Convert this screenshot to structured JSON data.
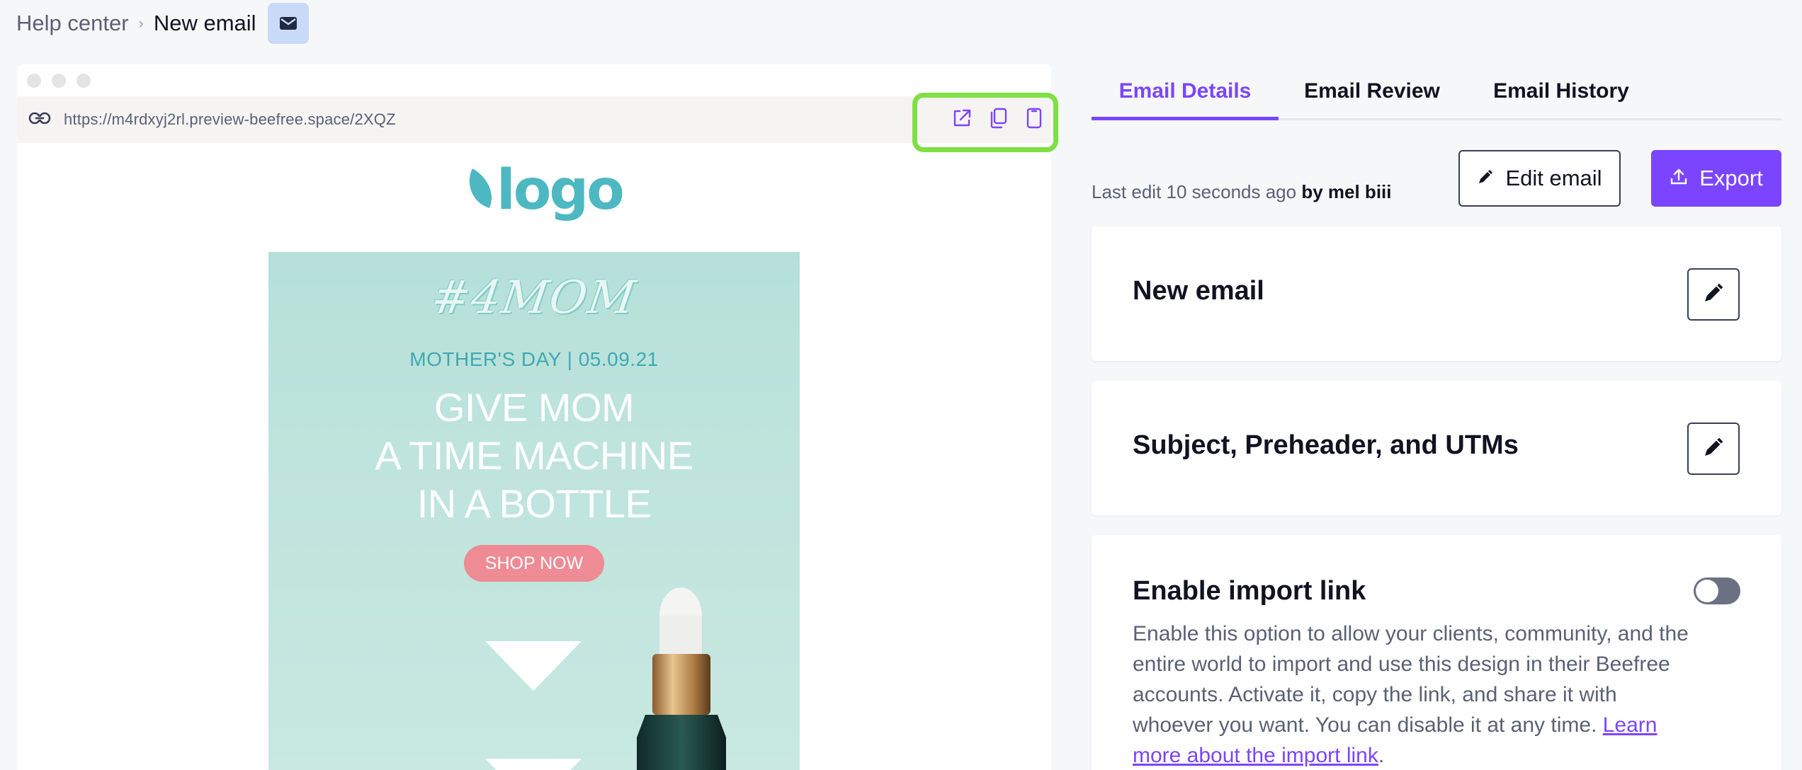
{
  "breadcrumb": {
    "parent": "Help center",
    "separator": "›",
    "current": "New email",
    "badge_icon": "envelope-icon"
  },
  "preview": {
    "url": "https://m4rdxyj2rl.preview-beefree.space/2XQZ",
    "actions": [
      "open-external-icon",
      "copy-icon",
      "mobile-view-icon"
    ],
    "highlight_color": "#7ee043",
    "email": {
      "logo_text": "logo",
      "hashtag": "#4MOM",
      "date_line": "MOTHER'S DAY | 05.09.21",
      "headline_lines": [
        "GIVE MOM",
        "A TIME MACHINE",
        "IN A BOTTLE"
      ],
      "cta_label": "SHOP NOW"
    }
  },
  "tabs": [
    {
      "label": "Email Details",
      "active": true
    },
    {
      "label": "Email Review",
      "active": false
    },
    {
      "label": "Email History",
      "active": false
    }
  ],
  "meta": {
    "last_edit_prefix": "Last edit 10 seconds ago",
    "last_edit_by": "by mel biii"
  },
  "actions": {
    "edit_label": "Edit email",
    "export_label": "Export"
  },
  "cards": {
    "name": {
      "title": "New email"
    },
    "subject": {
      "title": "Subject, Preheader, and UTMs"
    },
    "import": {
      "title": "Enable import link",
      "enabled": false,
      "description": "Enable this option to allow your clients, community, and the entire world to import and use this design in their Beefree accounts. Activate it, copy the link, and share it with whoever you want. You can disable it at any time.",
      "link_text": "Learn more about the import link",
      "link_suffix": "."
    }
  },
  "colors": {
    "accent": "#7b45ff",
    "teal_brand": "#4db8c2",
    "cta_pink": "#ee8b94"
  }
}
